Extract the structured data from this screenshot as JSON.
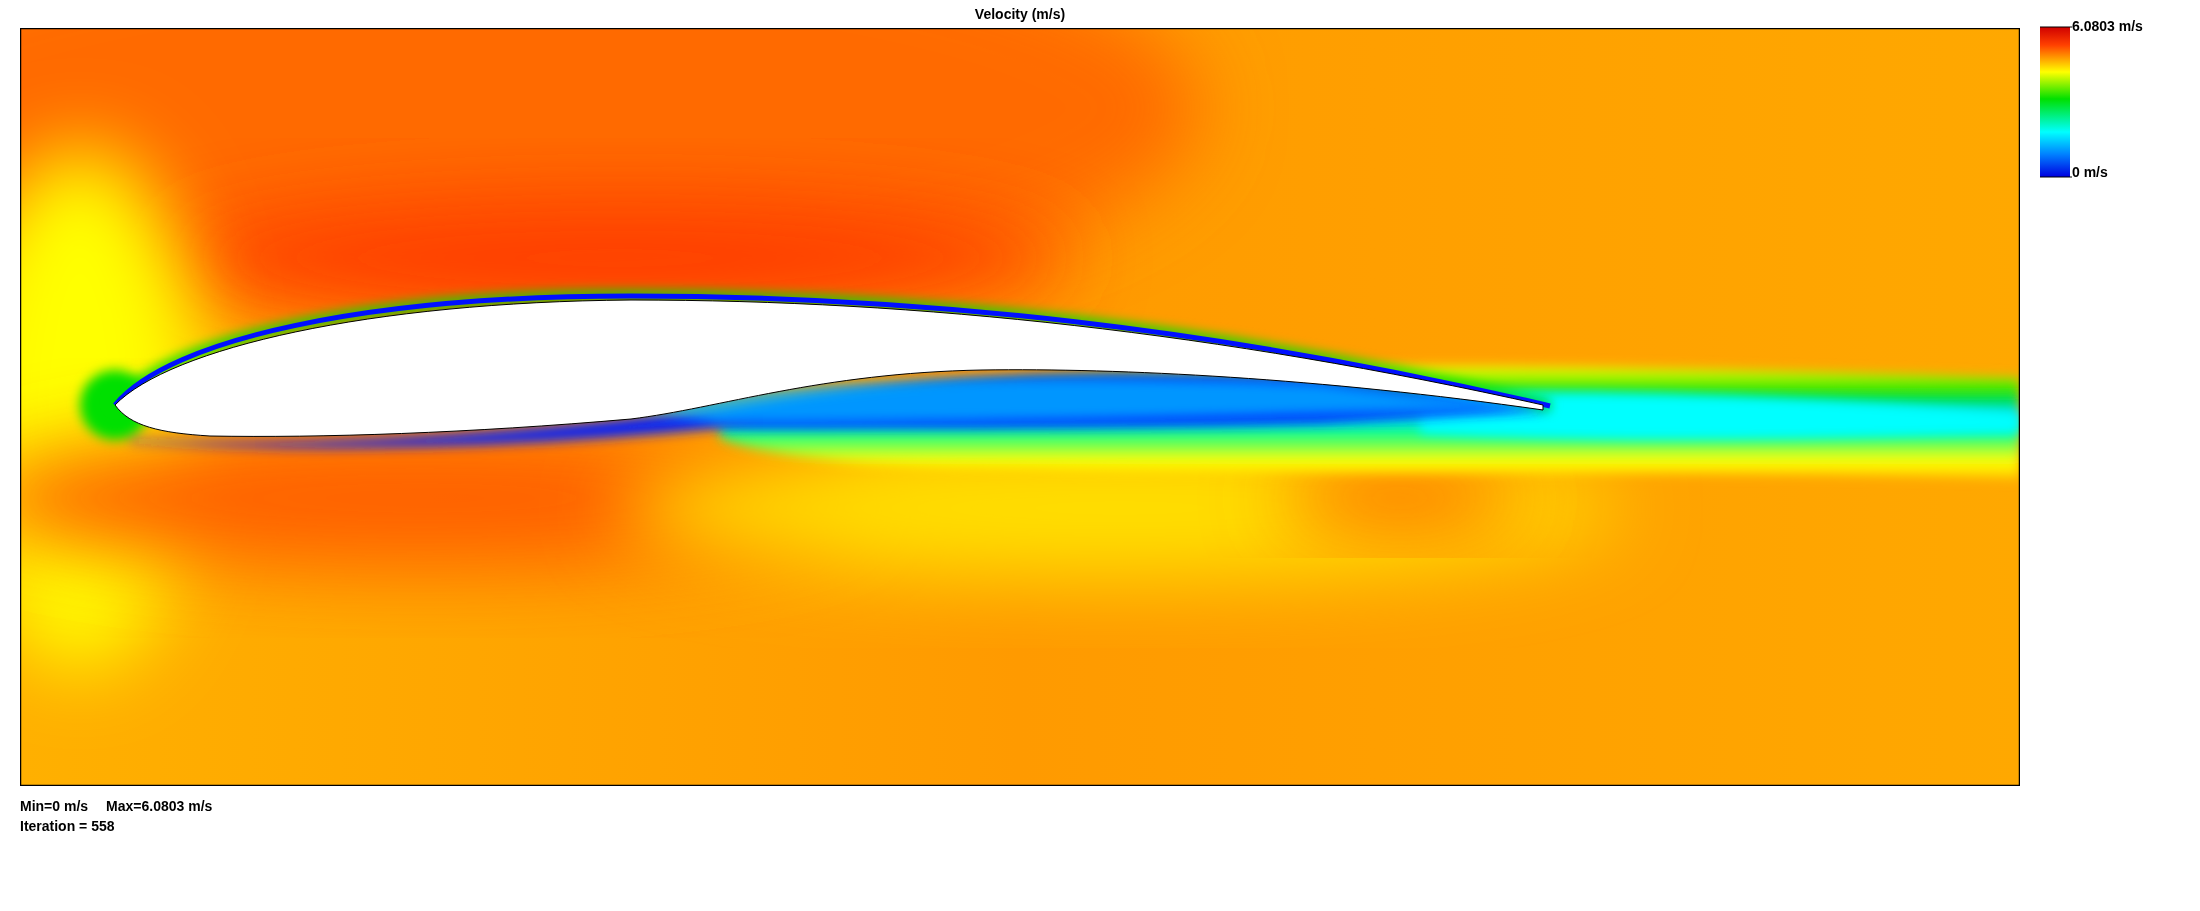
{
  "title": "Velocity (m/s)",
  "colorbar": {
    "max_label": "6.0803 m/s",
    "min_label": "0 m/s"
  },
  "stats": {
    "min": "Min=0 m/s",
    "max": "Max=6.0803 m/s",
    "iteration": "Iteration = 558"
  }
}
